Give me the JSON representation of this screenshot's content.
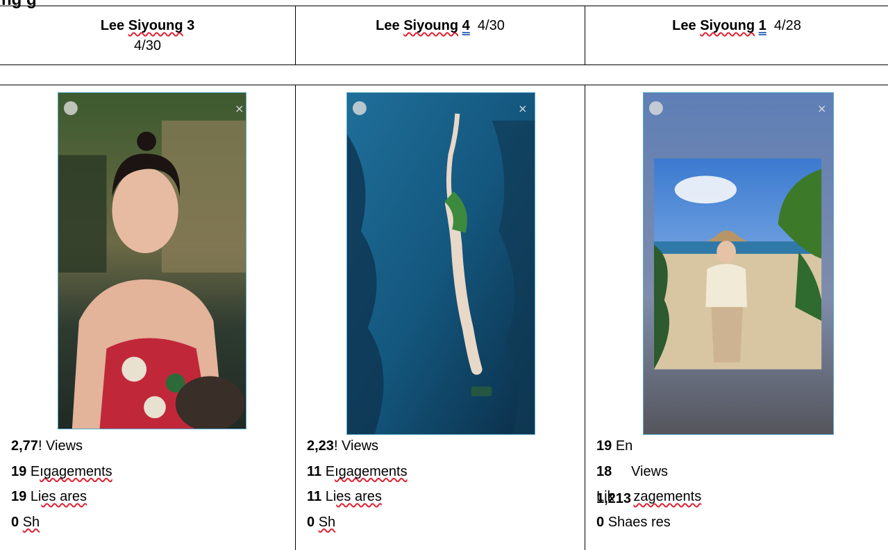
{
  "heading": "ng            g",
  "header": [
    {
      "name": "Lee Siyoung 3",
      "date": "4/30"
    },
    {
      "name": "Lee Siyoung 4",
      "date": "4/30"
    },
    {
      "name": "Lee Siyoung 1",
      "date": "4/28"
    }
  ],
  "stories": [
    {
      "stats": [
        {
          "num": "2,77",
          "label": "! Views"
        },
        {
          "num": "19",
          "label": "E",
          "tail": "ıgagements"
        },
        {
          "num": "19",
          "label": "Li",
          "tail": "es ares"
        },
        {
          "num": "0",
          "label": "",
          "tail": "Sh"
        }
      ]
    },
    {
      "stats": [
        {
          "num": "2,23",
          "label": "! Views"
        },
        {
          "num": "11",
          "label": "E",
          "tail": "ıgagements"
        },
        {
          "num": "11",
          "label": "Li",
          "tail": "es ares"
        },
        {
          "num": "0",
          "label": "",
          "tail": "Sh"
        }
      ]
    },
    {
      "overlay_num": "1,213",
      "stats": [
        {
          "num": "19",
          "label": "En",
          "tail": ""
        },
        {
          "num": "18",
          "label": "     Views",
          "tail": ""
        },
        {
          "num": "",
          "label": "Lik     ",
          "tail": "zagements"
        },
        {
          "num": "0",
          "label": "Sha",
          "tail": "es res"
        }
      ]
    }
  ]
}
